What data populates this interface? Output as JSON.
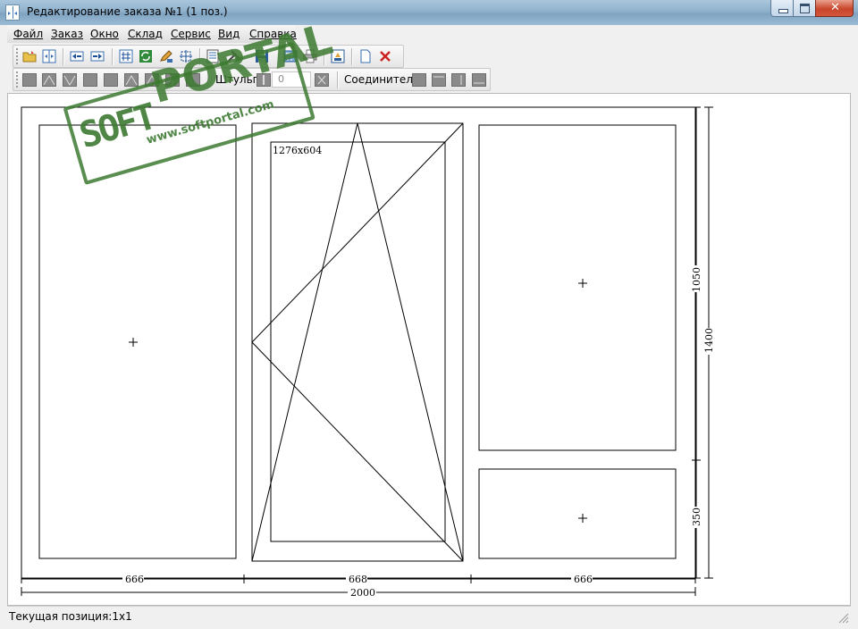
{
  "window": {
    "title": "Редактирование заказа №1 (1 поз.)",
    "controls": {
      "minimize": "minimize",
      "maximize": "maximize",
      "close": "✕"
    }
  },
  "menu": {
    "items": [
      "Файл",
      "Заказ",
      "Окно",
      "Склад",
      "Сервис",
      "Вид",
      "Справка"
    ]
  },
  "toolbar2": {
    "shtulp_label": "Штульп:",
    "shtulp_value": "0",
    "connector_label": "Соединитель:"
  },
  "drawing": {
    "sash_size_label": "1276x604",
    "dims": {
      "left_width": "666",
      "middle_width": "668",
      "right_width": "666",
      "total_width": "2000",
      "right_top_height": "1050",
      "right_bottom_height": "350",
      "total_height": "1400"
    }
  },
  "watermark": {
    "soft": "SOFT",
    "portal": "PORTAL",
    "url": "www.softportal.com"
  },
  "status": {
    "text": "Текущая позиция:1x1"
  }
}
